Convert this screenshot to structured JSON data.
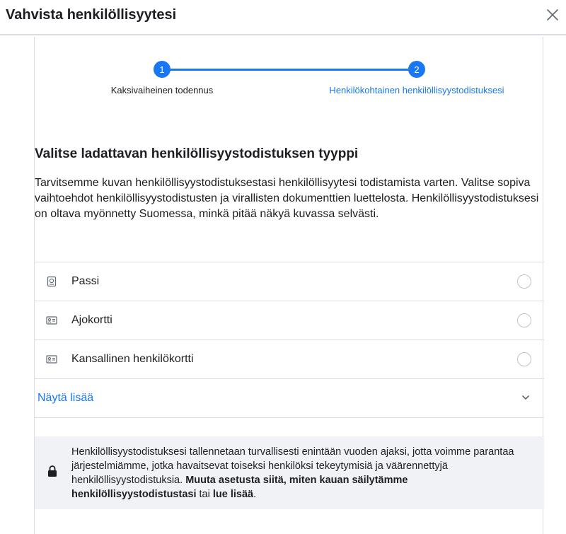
{
  "dialog": {
    "title": "Vahvista henkilöllisyytesi",
    "close_icon": "close-icon"
  },
  "stepper": {
    "steps": [
      {
        "number": "1",
        "label": "Kaksivaiheinen todennus",
        "active": false
      },
      {
        "number": "2",
        "label": "Henkilökohtainen henkilöllisyystodistuksesi",
        "active": true
      }
    ],
    "accent": "#1877f2"
  },
  "content": {
    "heading": "Valitse ladattavan henkilöllisyystodistuksen tyyppi",
    "description": "Tarvitsemme kuvan henkilöllisyystodistuksestasi henkilöllisyytesi todistamista varten. Valitse sopiva vaihtoehdot henkilöllisyystodistusten ja virallisten dokumenttien luettelosta. Henkilöllisyystodistuksesi on oltava myönnetty Suomessa, minkä pitää näkyä kuvassa selvästi."
  },
  "options": [
    {
      "label": "Passi",
      "icon": "passport-icon",
      "selected": false
    },
    {
      "label": "Ajokortti",
      "icon": "id-card-icon",
      "selected": false
    },
    {
      "label": "Kansallinen henkilökortti",
      "icon": "id-card-icon",
      "selected": false
    }
  ],
  "show_more": {
    "label": "Näytä lisää",
    "icon": "chevron-down-icon"
  },
  "notice": {
    "icon": "lock-icon",
    "text": "Henkilöllisyystodistuksesi tallennetaan turvallisesti enintään vuoden ajaksi, jotta voimme parantaa järjestelmiämme, jotka havaitsevat toiseksi henkilöksi tekeytymisiä ja väärennettyjä henkilöllisyystodistuksia.",
    "link_change": "Muuta asetusta siitä, miten kauan säilytämme henkilöllisyystodistustasi",
    "connector": "tai",
    "link_learn": "lue lisää",
    "end": "."
  }
}
